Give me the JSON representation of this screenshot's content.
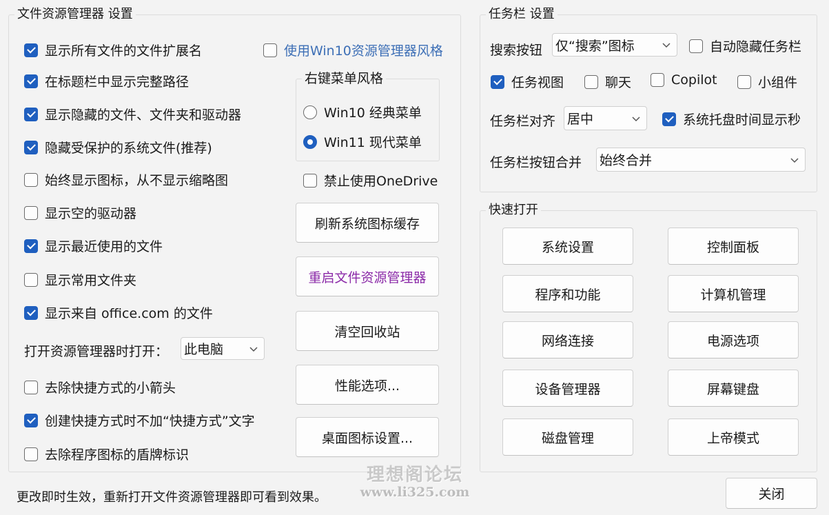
{
  "explorer": {
    "title": "文件资源管理器 设置",
    "options": [
      {
        "label": "显示所有文件的文件扩展名",
        "checked": true
      },
      {
        "label": "在标题栏中显示完整路径",
        "checked": true
      },
      {
        "label": "显示隐藏的文件、文件夹和驱动器",
        "checked": true
      },
      {
        "label": "隐藏受保护的系统文件(推荐)",
        "checked": true
      },
      {
        "label": "始终显示图标，从不显示缩略图",
        "checked": false
      },
      {
        "label": "显示空的驱动器",
        "checked": false
      },
      {
        "label": "显示最近使用的文件",
        "checked": true
      },
      {
        "label": "显示常用文件夹",
        "checked": false
      },
      {
        "label": "显示来自 office.com 的文件",
        "checked": true
      }
    ],
    "open_label": "打开资源管理器时打开：",
    "open_value": "此电脑",
    "options2": [
      {
        "label": "去除快捷方式的小箭头",
        "checked": false
      },
      {
        "label": "创建快捷方式时不加“快捷方式”文字",
        "checked": true
      },
      {
        "label": "去除程序图标的盾牌标识",
        "checked": false
      }
    ],
    "win10_style": {
      "label": "使用Win10资源管理器风格",
      "checked": false,
      "color": "#3d6fb6"
    },
    "context_menu": {
      "title": "右键菜单风格",
      "win10": {
        "label": "Win10 经典菜单",
        "selected": false
      },
      "win11": {
        "label": "Win11 现代菜单",
        "selected": true
      }
    },
    "disable_onedrive": {
      "label": "禁止使用OneDrive",
      "checked": false
    },
    "buttons": {
      "refresh_icons": "刷新系统图标缓存",
      "restart_explorer": "重启文件资源管理器",
      "restart_color": "#8b2aa8",
      "empty_recycle": "清空回收站",
      "performance": "性能选项...",
      "desktop_icons": "桌面图标设置..."
    }
  },
  "taskbar": {
    "title": "任务栏 设置",
    "search_label": "搜索按钮",
    "search_value": "仅“搜索”图标",
    "auto_hide": {
      "label": "自动隐藏任务栏",
      "checked": false
    },
    "task_view": {
      "label": "任务视图",
      "checked": true
    },
    "chat": {
      "label": "聊天",
      "checked": false
    },
    "copilot": {
      "label": "Copilot",
      "checked": false
    },
    "widgets": {
      "label": "小组件",
      "checked": false
    },
    "align_label": "任务栏对齐",
    "align_value": "居中",
    "show_seconds": {
      "label": "系统托盘时间显示秒",
      "checked": true
    },
    "combine_label": "任务栏按钮合并",
    "combine_value": "始终合并"
  },
  "quick_open": {
    "title": "快速打开",
    "buttons": [
      "系统设置",
      "控制面板",
      "程序和功能",
      "计算机管理",
      "网络连接",
      "电源选项",
      "设备管理器",
      "屏幕键盘",
      "磁盘管理",
      "上帝模式"
    ]
  },
  "footer": {
    "status": "更改即时生效，重新打开文件资源管理器即可看到效果。",
    "close": "关闭"
  },
  "watermark": {
    "line1": "理想阁论坛",
    "line2": "www.li325.com"
  },
  "colors": {
    "accent": "#1f5fbf",
    "background": "#f3f3f3"
  }
}
